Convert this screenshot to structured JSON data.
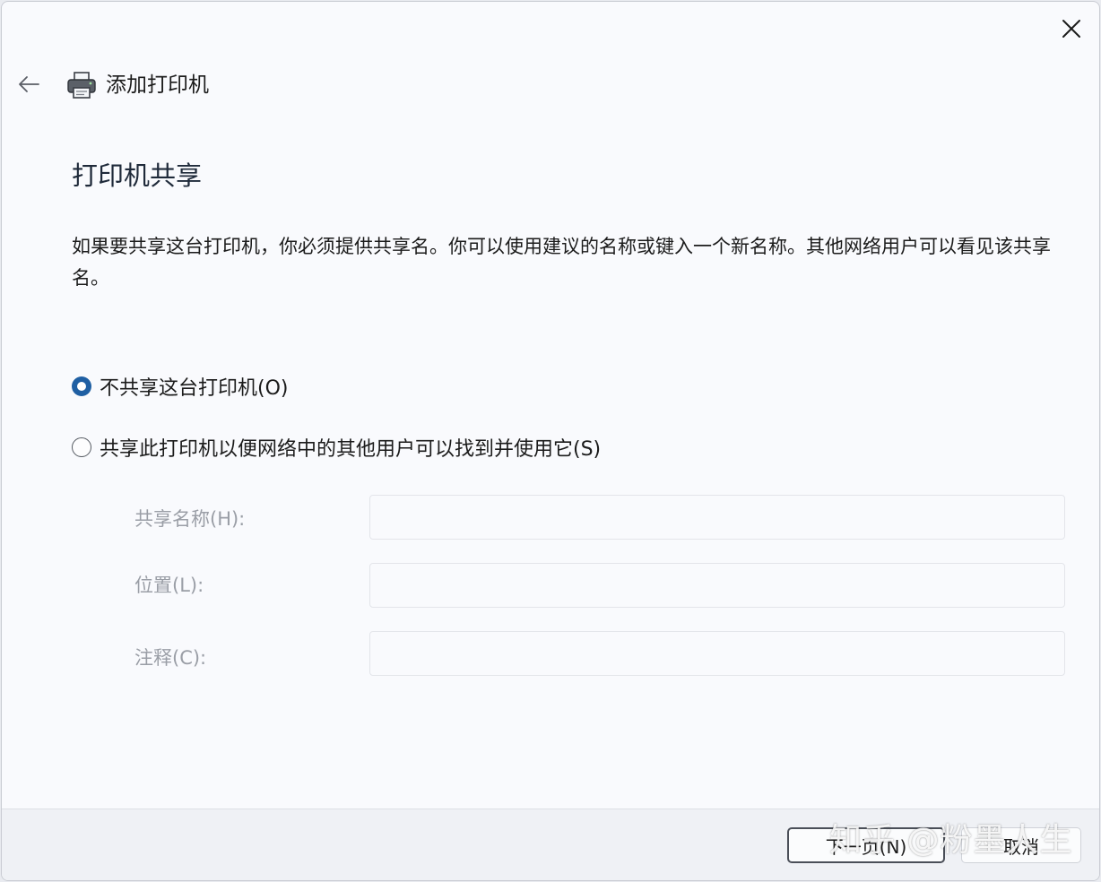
{
  "window": {
    "title": "添加打印机",
    "close_icon": "close-icon",
    "back_icon": "back-arrow-icon",
    "printer_icon": "printer-icon"
  },
  "page": {
    "heading": "打印机共享",
    "description": "如果要共享这台打印机，你必须提供共享名。你可以使用建议的名称或键入一个新名称。其他网络用户可以看见该共享名。"
  },
  "options": [
    {
      "label": "不共享这台打印机(O)",
      "selected": true
    },
    {
      "label": "共享此打印机以便网络中的其他用户可以找到并使用它(S)",
      "selected": false
    }
  ],
  "fields": [
    {
      "label": "共享名称(H):",
      "value": ""
    },
    {
      "label": "位置(L):",
      "value": ""
    },
    {
      "label": "注释(C):",
      "value": ""
    }
  ],
  "footer": {
    "next_label": "下一页(N)",
    "cancel_label": "取消"
  },
  "watermark": "知乎 @粉墨人生",
  "colors": {
    "accent": "#1f5fa3",
    "background": "#f9fafd",
    "disabled_text": "#9a9ea6"
  }
}
